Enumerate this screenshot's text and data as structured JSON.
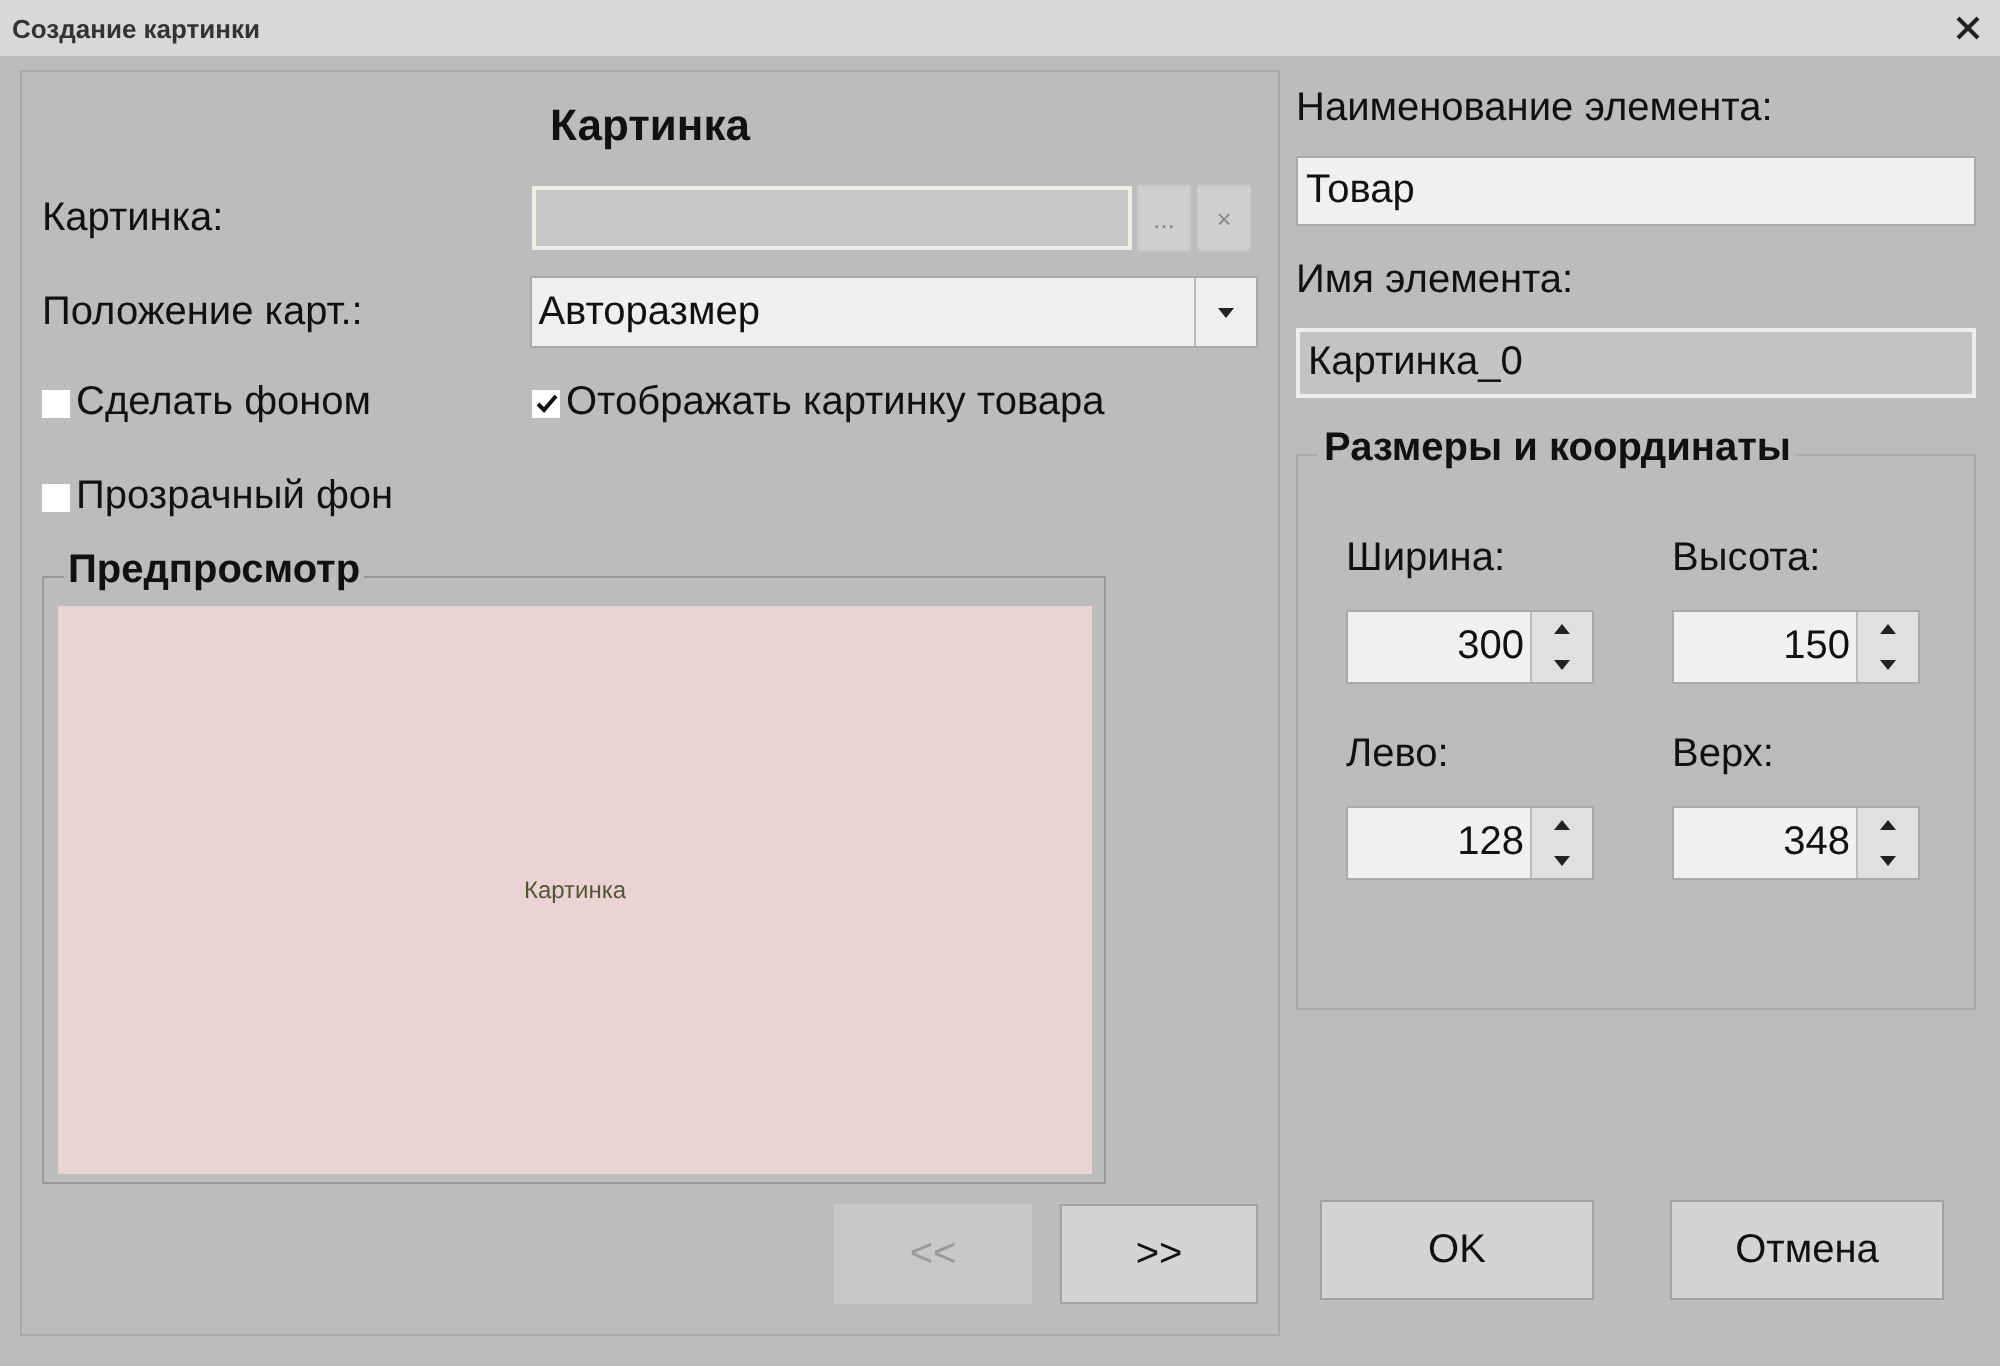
{
  "window": {
    "title": "Создание картинки"
  },
  "picture_panel": {
    "heading": "Картинка",
    "picture_field": {
      "label": "Картинка:",
      "browse": "...",
      "clear": "×",
      "disabled": true
    },
    "position_field": {
      "label": "Положение карт.:",
      "value": "Авторазмер"
    },
    "checkboxes": [
      {
        "label": "Сделать фоном",
        "checked": false
      },
      {
        "label": "Отображать картинку товара",
        "checked": true
      },
      {
        "label": "Прозрачный фон",
        "checked": false
      }
    ],
    "preview": {
      "title": "Предпросмотр",
      "placeholder_text": "Картинка"
    },
    "nav_buttons": [
      {
        "label": "<<",
        "disabled": true
      },
      {
        "label": ">>",
        "disabled": false
      }
    ]
  },
  "element_name": {
    "label": "Наименование элемента:",
    "value": "Товар"
  },
  "element_id": {
    "label": "Имя элемента:",
    "value": "Картинка_0",
    "disabled": true
  },
  "geometry": {
    "title": "Размеры и координаты",
    "fields": [
      {
        "label": "Ширина:",
        "value": "300"
      },
      {
        "label": "Высота:",
        "value": "150"
      },
      {
        "label": "Лево:",
        "value": "128"
      },
      {
        "label": "Верх:",
        "value": "348"
      }
    ]
  },
  "buttons": [
    {
      "label": "OK"
    },
    {
      "label": "Отмена"
    }
  ]
}
